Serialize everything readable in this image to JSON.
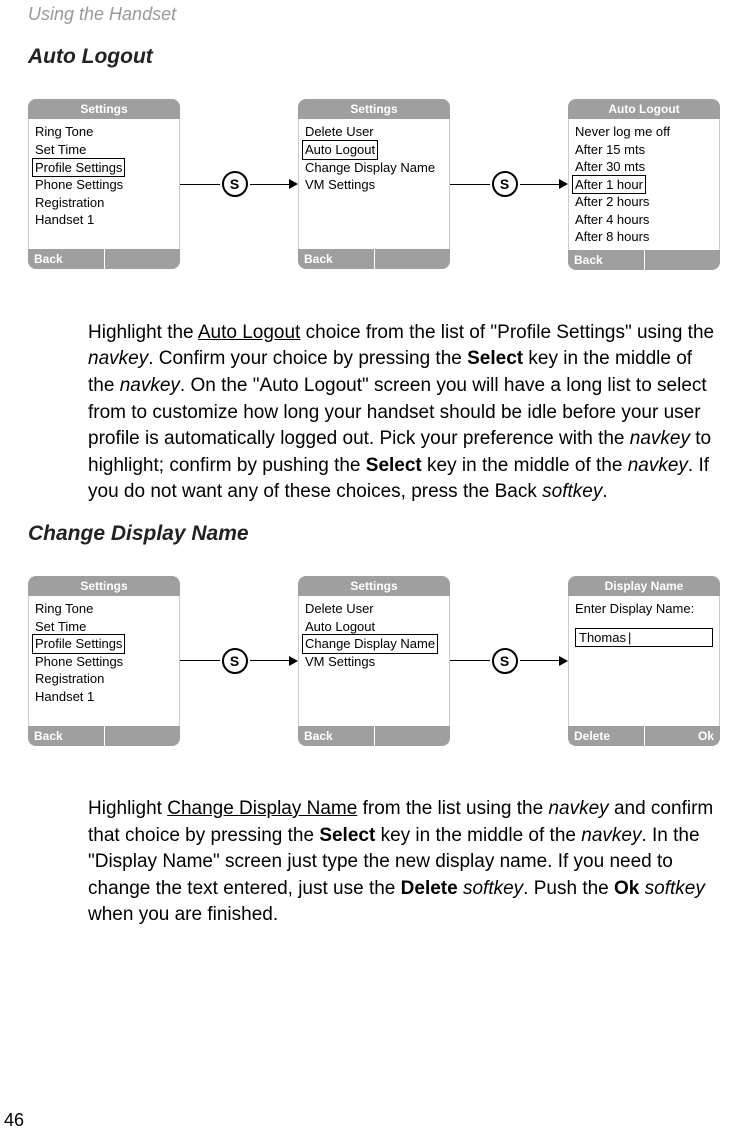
{
  "header": {
    "section": "Using the Handset"
  },
  "section1": {
    "title": "Auto Logout",
    "screens": [
      {
        "title": "Settings",
        "items": [
          "Ring Tone",
          "Set Time",
          "Profile Settings",
          "Phone Settings",
          "Registration",
          "Handset 1"
        ],
        "highlightIndex": 2,
        "footerLeft": "Back",
        "footerRight": ""
      },
      {
        "title": "Settings",
        "items": [
          "Delete User",
          "Auto Logout",
          "Change Display Name",
          "VM Settings"
        ],
        "highlightIndex": 1,
        "footerLeft": "Back",
        "footerRight": ""
      },
      {
        "title": "Auto Logout",
        "items": [
          "Never log me off",
          "After 15 mts",
          "After 30 mts",
          "After 1 hour",
          "After 2 hours",
          "After 4 hours",
          "After 8 hours"
        ],
        "highlightIndex": 3,
        "footerLeft": "Back",
        "footerRight": ""
      }
    ],
    "paragraph": {
      "p1a": "Highlight the ",
      "p1b": "Auto Logout",
      "p1c": " choice from the list of \"Profile Settings\" using the ",
      "p1d": "navkey",
      "p1e": ". Confirm your choice by pressing the ",
      "p1f": "Select",
      "p1g": " key in the middle of the ",
      "p1h": "navkey",
      "p1i": ". On the \"Auto Logout\" screen you will have a long list to select from to customize how long your handset should be idle before your user profile is automatically logged out. Pick your preference with the ",
      "p1j": "navkey",
      "p1k": " to highlight; confirm by pushing the ",
      "p1l": "Select",
      "p1m": " key in the middle of the ",
      "p1n": "navkey",
      "p1o": ". If you do not want any of these choices, press the Back ",
      "p1p": "softkey",
      "p1q": "."
    }
  },
  "section2": {
    "title": "Change Display Name",
    "screens": [
      {
        "title": "Settings",
        "items": [
          "Ring Tone",
          "Set Time",
          "Profile Settings",
          "Phone Settings",
          "Registration",
          "Handset 1"
        ],
        "highlightIndex": 2,
        "footerLeft": "Back",
        "footerRight": ""
      },
      {
        "title": "Settings",
        "items": [
          "Delete User",
          "Auto Logout",
          "Change Display Name",
          "VM Settings"
        ],
        "highlightIndex": 2,
        "footerLeft": "Back",
        "footerRight": ""
      },
      {
        "title": "Display Name",
        "prompt": "Enter Display Name:",
        "inputValue": "Thomas",
        "footerLeft": "Delete",
        "footerRight": "Ok"
      }
    ],
    "paragraph": {
      "p2a": "Highlight ",
      "p2b": "Change Display Name",
      "p2c": " from the list using the ",
      "p2d": "navkey",
      "p2e": " and confirm that choice by pressing the ",
      "p2f": "Select",
      "p2g": " key in the middle of the ",
      "p2h": "navkey",
      "p2i": ". In the \"Display Name\" screen just type the new display name. If you need to change the text entered, just use the ",
      "p2j": "Delete",
      "p2k": " ",
      "p2l": "softkey",
      "p2m": ". Push the ",
      "p2n": "Ok",
      "p2o": " ",
      "p2p": "softkey",
      "p2q": " when you are finished."
    }
  },
  "pageNumber": "46",
  "sButton": "S"
}
